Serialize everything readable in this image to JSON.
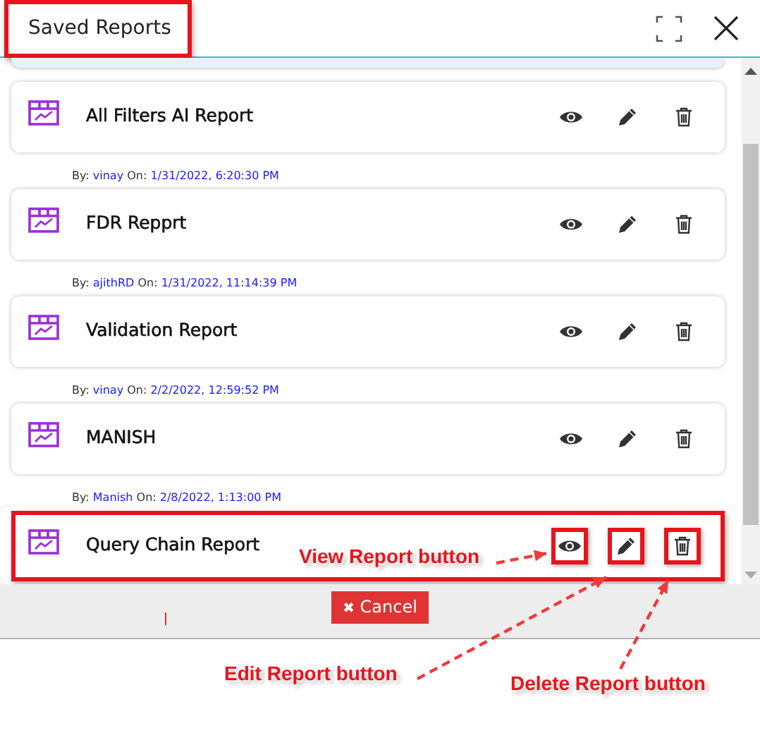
{
  "window": {
    "title": "Saved Reports",
    "highlighted": true
  },
  "reports": [
    {
      "title": "All Filters AI Report",
      "highlighted": false,
      "meta": {
        "by": "By:",
        "author": "vinay",
        "on": "On:",
        "date": "1/31/2022, 6:20:30 PM"
      }
    },
    {
      "title": "FDR Repprt",
      "highlighted": false,
      "meta": {
        "by": "By:",
        "author": "ajithRD",
        "on": "On:",
        "date": "1/31/2022, 11:14:39 PM"
      }
    },
    {
      "title": "Validation Report",
      "highlighted": false,
      "meta": {
        "by": "By:",
        "author": "vinay",
        "on": "On:",
        "date": "2/2/2022, 12:59:52 PM"
      }
    },
    {
      "title": "MANISH",
      "highlighted": false,
      "meta": {
        "by": "By:",
        "author": "Manish",
        "on": "On:",
        "date": "2/8/2022, 1:13:00 PM"
      }
    },
    {
      "title": "Query Chain Report",
      "highlighted": true
    }
  ],
  "cancel_button": {
    "icon": "✖",
    "label": "Cancel"
  },
  "annotations": [
    {
      "text": "View Report button"
    },
    {
      "text": "Edit Report button"
    },
    {
      "text": "Delete Report button"
    }
  ]
}
